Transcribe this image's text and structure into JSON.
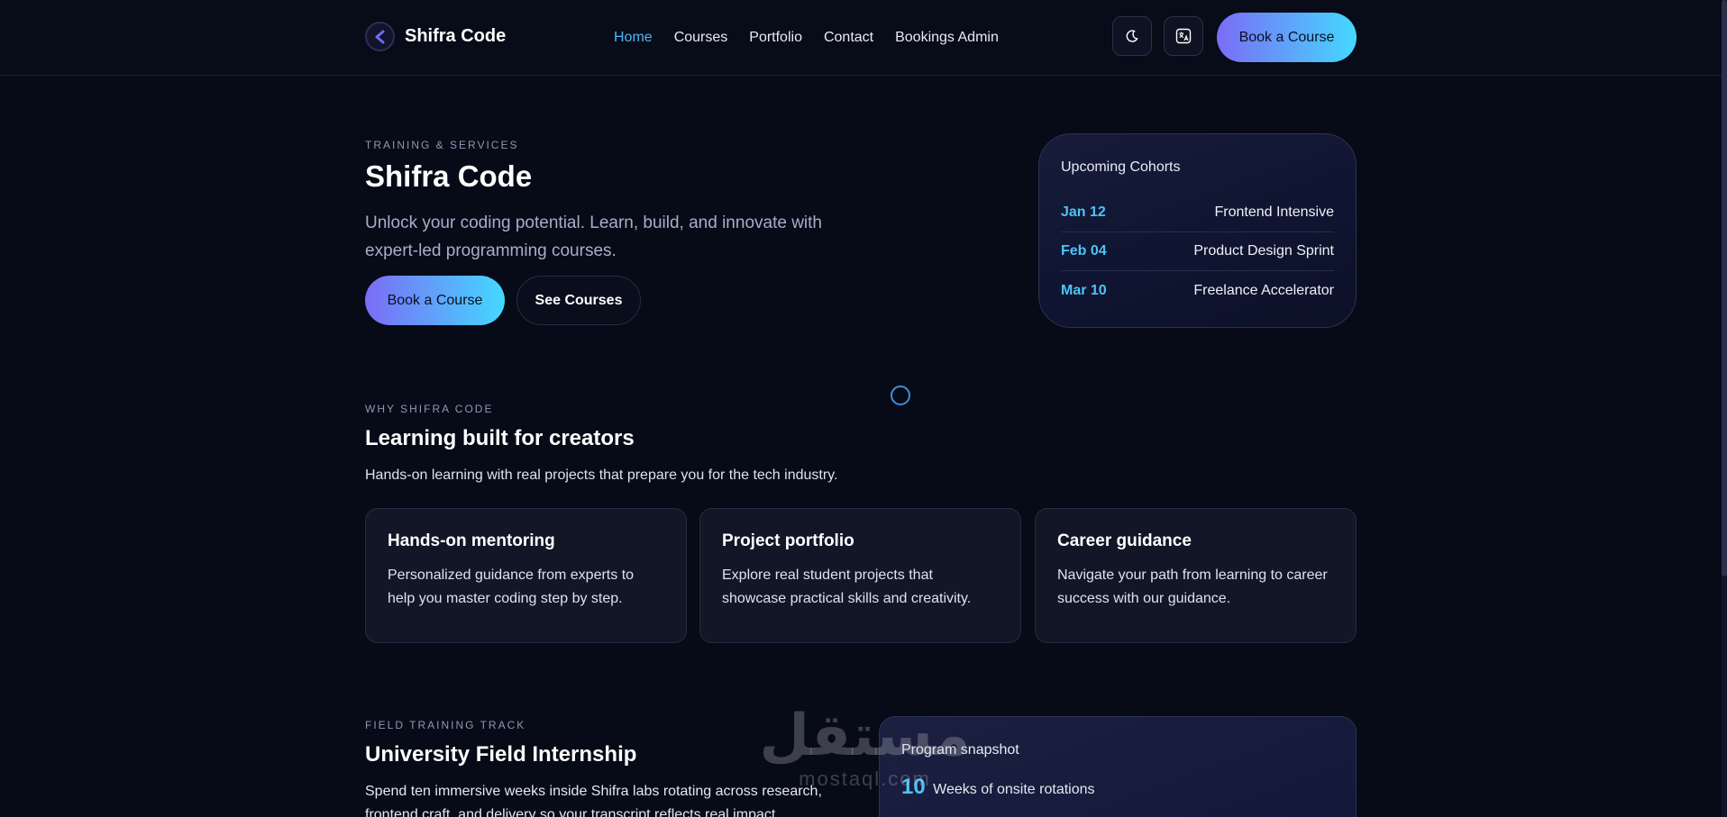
{
  "header": {
    "brand": "Shifra Code",
    "nav": [
      "Home",
      "Courses",
      "Portfolio",
      "Contact",
      "Bookings Admin"
    ],
    "active_nav": "Home",
    "theme_icon": "moon-icon",
    "language_icon": "translate-icon",
    "book_label": "Book a Course"
  },
  "hero": {
    "eyebrow": "TRAINING & SERVICES",
    "title": "Shifra Code",
    "subtitle": "Unlock your coding potential. Learn, build, and innovate with expert-led programming courses.",
    "primary_label": "Book a Course",
    "secondary_label": "See Courses"
  },
  "cohorts": {
    "title": "Upcoming Cohorts",
    "items": [
      {
        "date": "Jan 12",
        "name": "Frontend Intensive"
      },
      {
        "date": "Feb 04",
        "name": "Product Design Sprint"
      },
      {
        "date": "Mar 10",
        "name": "Freelance Accelerator"
      }
    ]
  },
  "why": {
    "eyebrow": "WHY SHIFRA CODE",
    "title": "Learning built for creators",
    "text": "Hands-on learning with real projects that prepare you for the tech industry.",
    "cards": [
      {
        "title": "Hands-on mentoring",
        "text": "Personalized guidance from experts to help you master coding step by step."
      },
      {
        "title": "Project portfolio",
        "text": "Explore real student projects that showcase practical skills and creativity."
      },
      {
        "title": "Career guidance",
        "text": "Navigate your path from learning to career success with our guidance."
      }
    ]
  },
  "internship": {
    "eyebrow": "FIELD TRAINING TRACK",
    "title": "University Field Internship",
    "text": "Spend ten immersive weeks inside Shifra labs rotating across research, frontend craft, and delivery so your transcript reflects real impact.",
    "snapshot_title": "Program snapshot",
    "stat_value": "10",
    "stat_label": "Weeks of onsite rotations"
  },
  "watermark": {
    "arabic": "مستقل",
    "latin": "mostaql.com"
  },
  "colors": {
    "background": "#070a17",
    "accent": "#4fc3f7",
    "gradient_start": "#7b6cf6",
    "gradient_end": "#44d8ff"
  }
}
